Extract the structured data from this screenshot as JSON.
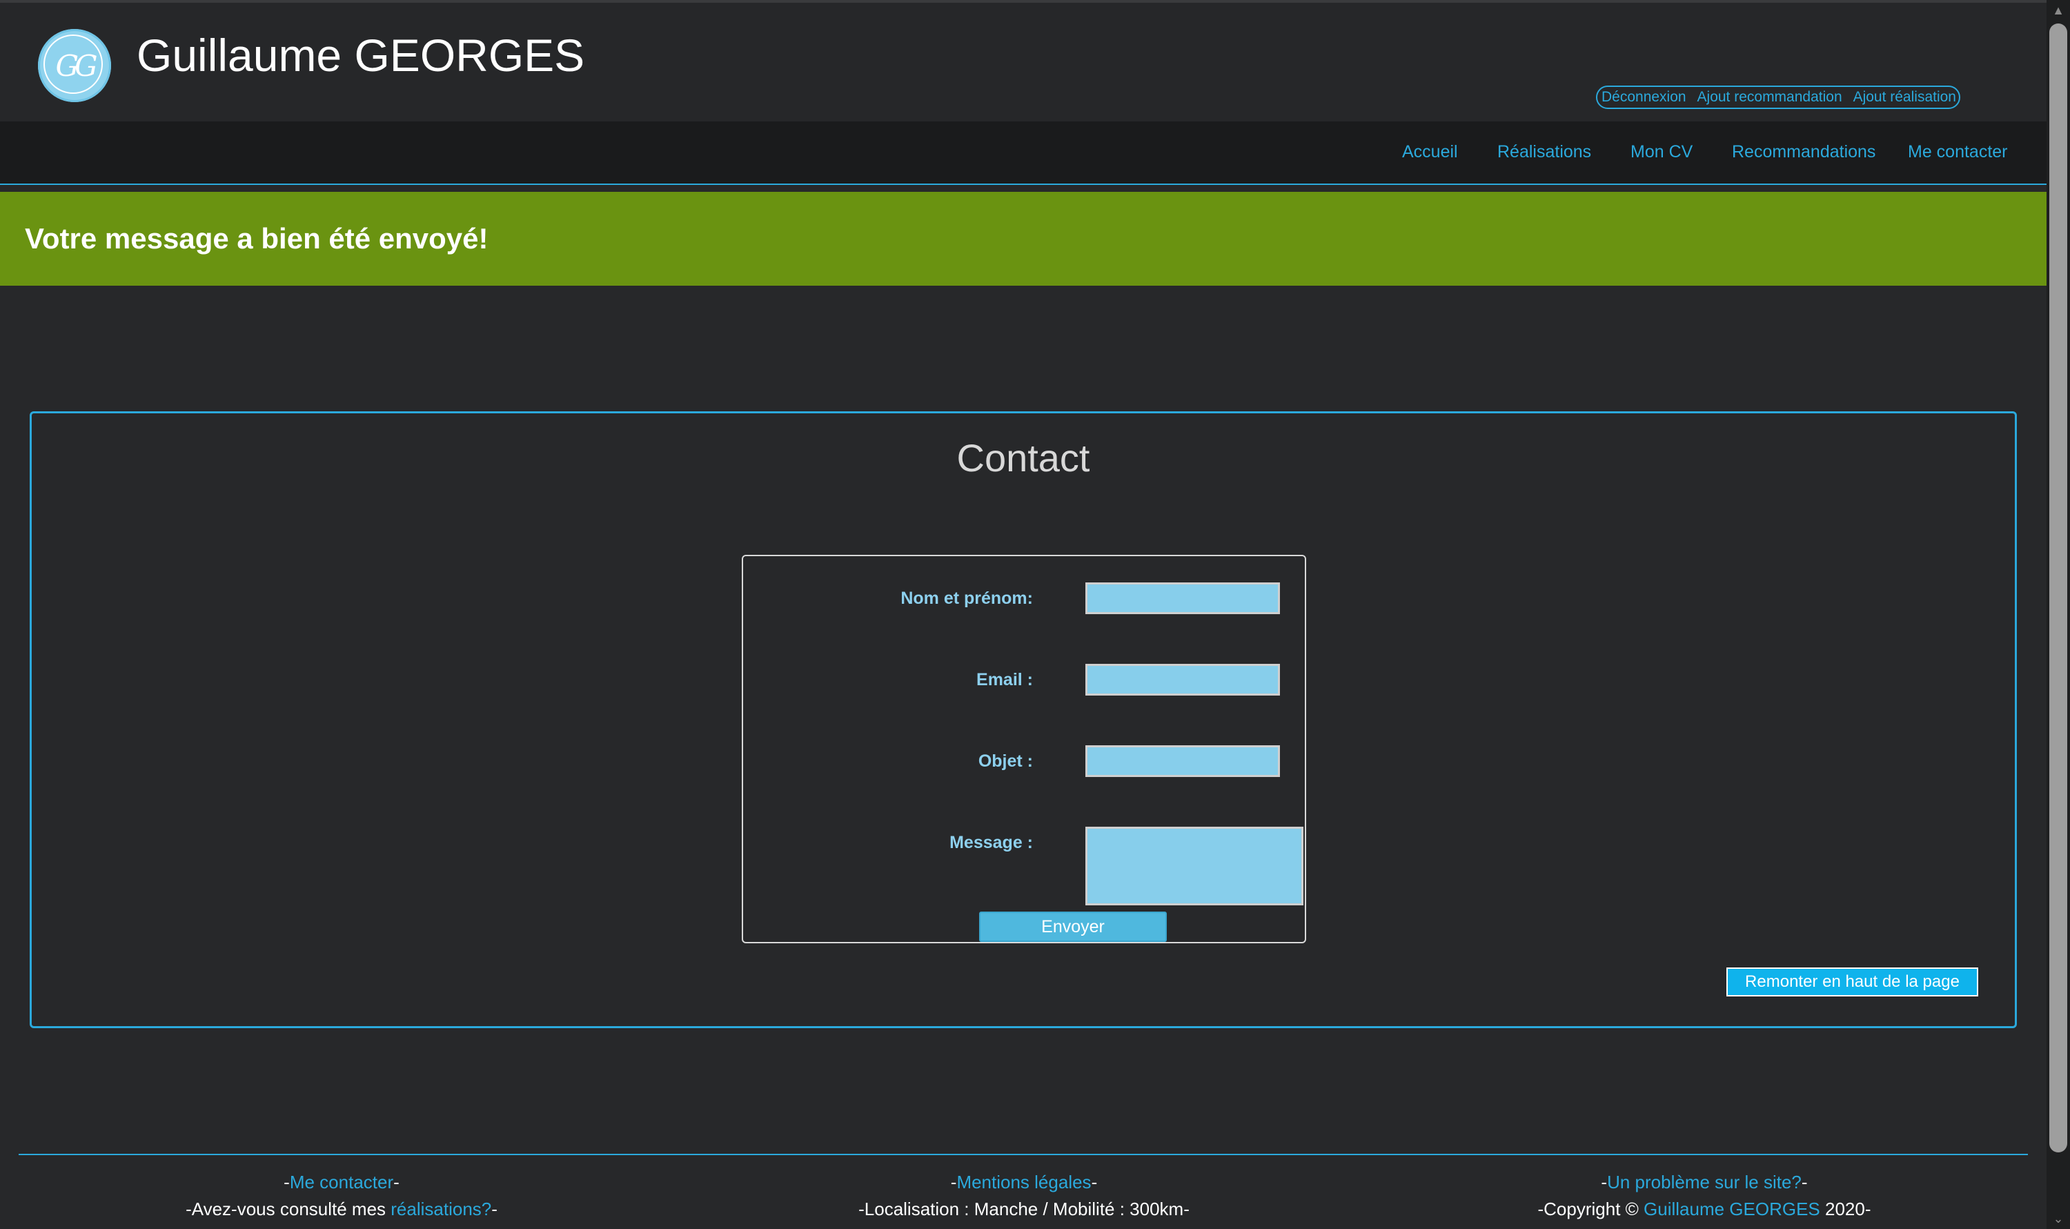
{
  "header": {
    "logo_text": "GG",
    "site_title": "Guillaume GEORGES",
    "admin_links": [
      "Déconnexion",
      "Ajout recommandation",
      "Ajout réalisation"
    ]
  },
  "nav": {
    "items": [
      "Accueil",
      "Réalisations",
      "Mon CV",
      "Recommandations",
      "Me contacter"
    ]
  },
  "flash": {
    "message": "Votre message a bien été envoyé!"
  },
  "contact": {
    "title": "Contact",
    "fields": {
      "name_label": "Nom et prénom:",
      "email_label": "Email :",
      "subject_label": "Objet :",
      "message_label": "Message :"
    },
    "submit_label": "Envoyer",
    "back_to_top_label": "Remonter en haut de la page"
  },
  "footer": {
    "col1": {
      "link": "Me contacter",
      "text_before": "-Avez-vous consulté mes ",
      "text_link": "réalisations?"
    },
    "col2": {
      "link": "Mentions légales",
      "text": "-Localisation : Manche / Mobilité : 300km-"
    },
    "col3": {
      "link": "Un problème sur le site?",
      "text_before": "-Copyright © ",
      "text_link": "Guillaume GEORGES",
      "text_after": " 2020-"
    }
  },
  "colors": {
    "background": "#27282a",
    "accent": "#2ba9dc",
    "flash_green": "#6a9311",
    "input_bg": "#87ceeb"
  }
}
